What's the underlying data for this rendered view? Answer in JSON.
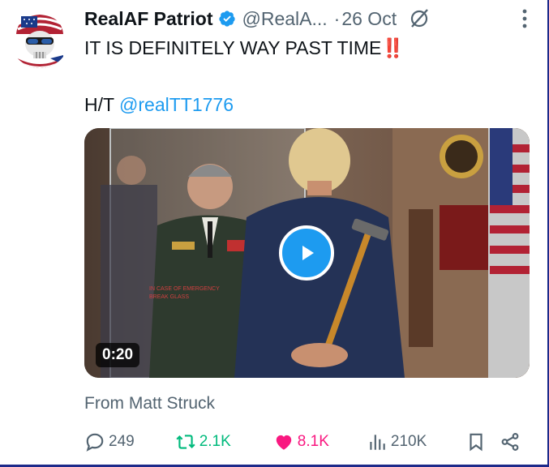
{
  "author": {
    "name": "RealAF Patriot",
    "handle": "@RealA...",
    "separator": "·",
    "date": "26 Oct"
  },
  "post": {
    "text_line1": "IT IS DEFINITELY WAY PAST TIME",
    "emoji": "‼️",
    "ht_prefix": "H/T ",
    "ht_mention": "@realTT1776"
  },
  "media": {
    "duration": "0:20",
    "caption_on_glass": "IN CASE OF EMERGENCY BREAK GLASS"
  },
  "source": "From Matt Struck",
  "actions": {
    "replies": "249",
    "reposts": "2.1K",
    "likes": "8.1K",
    "views": "210K"
  },
  "colors": {
    "accent": "#1d9bf0",
    "repost": "#00ba7c",
    "like": "#f91880",
    "muted": "#536471"
  },
  "icons": [
    "verified-icon",
    "grok-icon",
    "more-icon",
    "play-icon",
    "reply-icon",
    "repost-icon",
    "like-icon",
    "views-icon",
    "bookmark-icon",
    "share-icon"
  ]
}
